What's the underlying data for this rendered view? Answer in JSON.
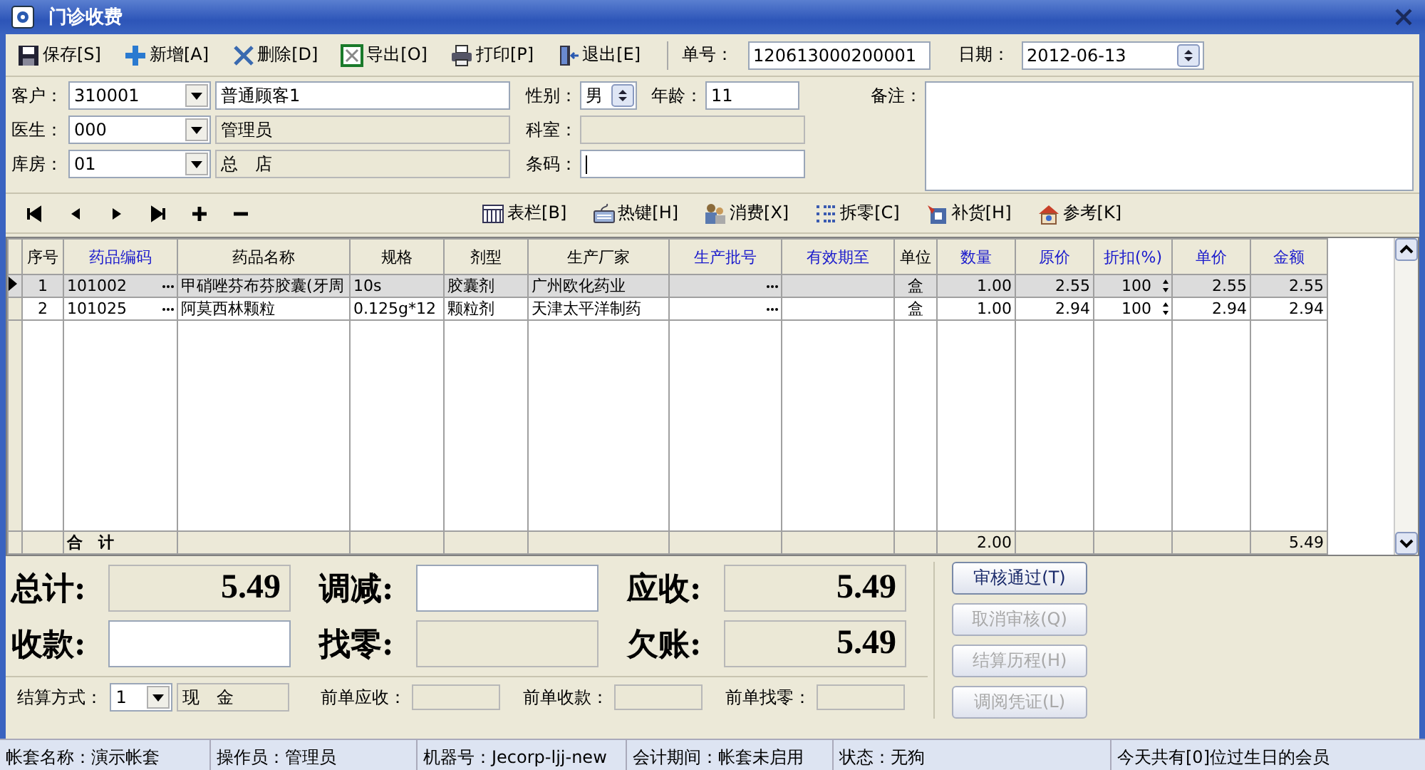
{
  "window": {
    "title": "门诊收费"
  },
  "toolbar": [
    {
      "label": "保存[S]",
      "kind": "save"
    },
    {
      "label": "新增[A]",
      "kind": "add"
    },
    {
      "label": "删除[D]",
      "kind": "delete"
    },
    {
      "label": "导出[O]",
      "kind": "export"
    },
    {
      "label": "打印[P]",
      "kind": "print"
    },
    {
      "label": "退出[E]",
      "kind": "exit"
    }
  ],
  "order_no": {
    "label": "单号：",
    "value": "120613000200001"
  },
  "date": {
    "label": "日期：",
    "value": "2012-06-13"
  },
  "party_rows": [
    {
      "label": "客户：",
      "code": "310001",
      "name": "普通顾客1",
      "name_disabled": false
    },
    {
      "label": "医生：",
      "code": "000",
      "name": "管理员",
      "name_disabled": true
    },
    {
      "label": "库房：",
      "code": "01",
      "name": "总　店",
      "name_disabled": true
    }
  ],
  "gender": {
    "label": "性别：",
    "value": "男"
  },
  "age": {
    "label": "年龄：",
    "value": "11"
  },
  "department": {
    "label": "科室：",
    "disabled": true
  },
  "barcode": {
    "label": "条码：",
    "focused": true
  },
  "remark": {
    "label": "备注："
  },
  "tools": [
    {
      "label": "表栏[B]",
      "kind": "columns"
    },
    {
      "label": "热键[H]",
      "kind": "hotkey"
    },
    {
      "label": "消费[X]",
      "kind": "consume"
    },
    {
      "label": "拆零[C]",
      "kind": "split"
    },
    {
      "label": "补货[H]",
      "kind": "restock"
    },
    {
      "label": "参考[K]",
      "kind": "reference"
    }
  ],
  "table": {
    "columns": [
      {
        "label": "序号",
        "color": "#000000"
      },
      {
        "label": "药品编码",
        "color": "#1a1acc"
      },
      {
        "label": "药品名称",
        "color": "#000000"
      },
      {
        "label": "规格",
        "color": "#000000"
      },
      {
        "label": "剂型",
        "color": "#000000"
      },
      {
        "label": "生产厂家",
        "color": "#000000"
      },
      {
        "label": "生产批号",
        "color": "#1a1acc"
      },
      {
        "label": "有效期至",
        "color": "#1a1acc"
      },
      {
        "label": "单位",
        "color": "#000000"
      },
      {
        "label": "数量",
        "color": "#1a1acc"
      },
      {
        "label": "原价",
        "color": "#1a1acc"
      },
      {
        "label": "折扣(%)",
        "color": "#1a1acc"
      },
      {
        "label": "单价",
        "color": "#1a1acc"
      },
      {
        "label": "金额",
        "color": "#1a1acc"
      }
    ],
    "rows": [
      {
        "no": "1",
        "code": "101002",
        "name": "甲硝唑芬布芬胶囊(牙周",
        "spec": "10s",
        "form": "胶囊剂",
        "maker": "广州欧化药业",
        "unit": "盒",
        "qty": "1.00",
        "price": "2.55",
        "discount": "100",
        "unit_price": "2.55",
        "amount": "2.55",
        "selected": true
      },
      {
        "no": "2",
        "code": "101025",
        "name": "阿莫西林颗粒",
        "spec": "0.125g*12",
        "form": "颗粒剂",
        "maker": "天津太平洋制药",
        "unit": "盒",
        "qty": "1.00",
        "price": "2.94",
        "discount": "100",
        "unit_price": "2.94",
        "amount": "2.94",
        "selected": false
      }
    ],
    "totals": {
      "label": "合　计",
      "qty": "2.00",
      "amount": "5.49"
    }
  },
  "summary": [
    {
      "label": "总计:",
      "value": "5.49",
      "editable": false
    },
    {
      "label": "调减:",
      "editable": true
    },
    {
      "label": "应收:",
      "value": "5.49",
      "editable": false
    },
    {
      "label": "收款:",
      "editable": true
    },
    {
      "label": "找零:",
      "editable": false
    },
    {
      "label": "欠账:",
      "value": "5.49",
      "editable": false
    }
  ],
  "settlement": {
    "label": "结算方式：",
    "code": "1",
    "name": "现　金"
  },
  "previous": [
    {
      "label": "前单应收："
    },
    {
      "label": "前单收款："
    },
    {
      "label": "前单找零："
    }
  ],
  "actions": [
    {
      "label": "审核通过(T)",
      "disabled": false
    },
    {
      "label": "取消审核(Q)",
      "disabled": true
    },
    {
      "label": "结算历程(H)",
      "disabled": true
    },
    {
      "label": "调阅凭证(L)",
      "disabled": true
    }
  ],
  "status_bar": [
    "帐套名称：演示帐套",
    "操作员：管理员",
    "机器号：Jecorp-ljj-new",
    "会计期间：帐套未启用",
    "状态：无狗",
    "今天共有[0]位过生日的会员"
  ]
}
